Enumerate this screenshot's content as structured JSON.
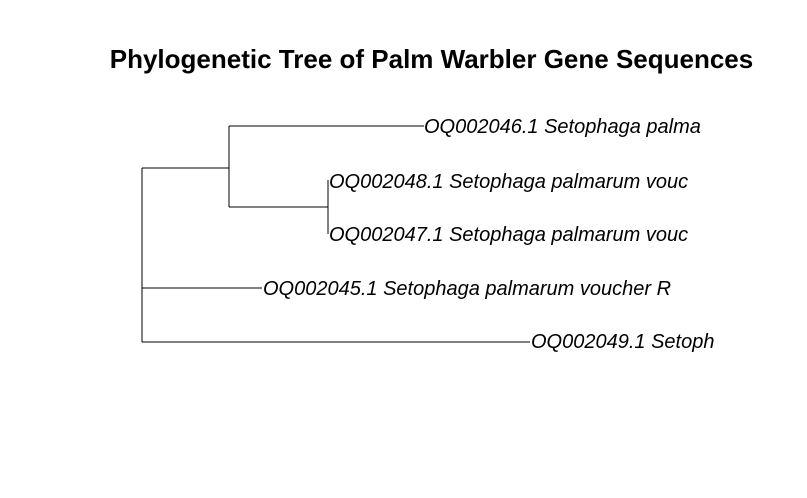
{
  "title": "Phylogenetic Tree of Palm Warbler Gene Sequences",
  "tree": {
    "tips": [
      {
        "id": "t46",
        "label": "OQ002046.1 Setophaga palma"
      },
      {
        "id": "t48",
        "label": "OQ002048.1 Setophaga palmarum vouc"
      },
      {
        "id": "t47",
        "label": "OQ002047.1 Setophaga palmarum vouc"
      },
      {
        "id": "t45",
        "label": "OQ002045.1 Setophaga palmarum voucher R"
      },
      {
        "id": "t49",
        "label": "OQ002049.1 Setoph"
      }
    ],
    "newick": "(((OQ002046.1,(OQ002048.1,OQ002047.1)),OQ002045.1),OQ002049.1);",
    "line_color": "#000000"
  }
}
